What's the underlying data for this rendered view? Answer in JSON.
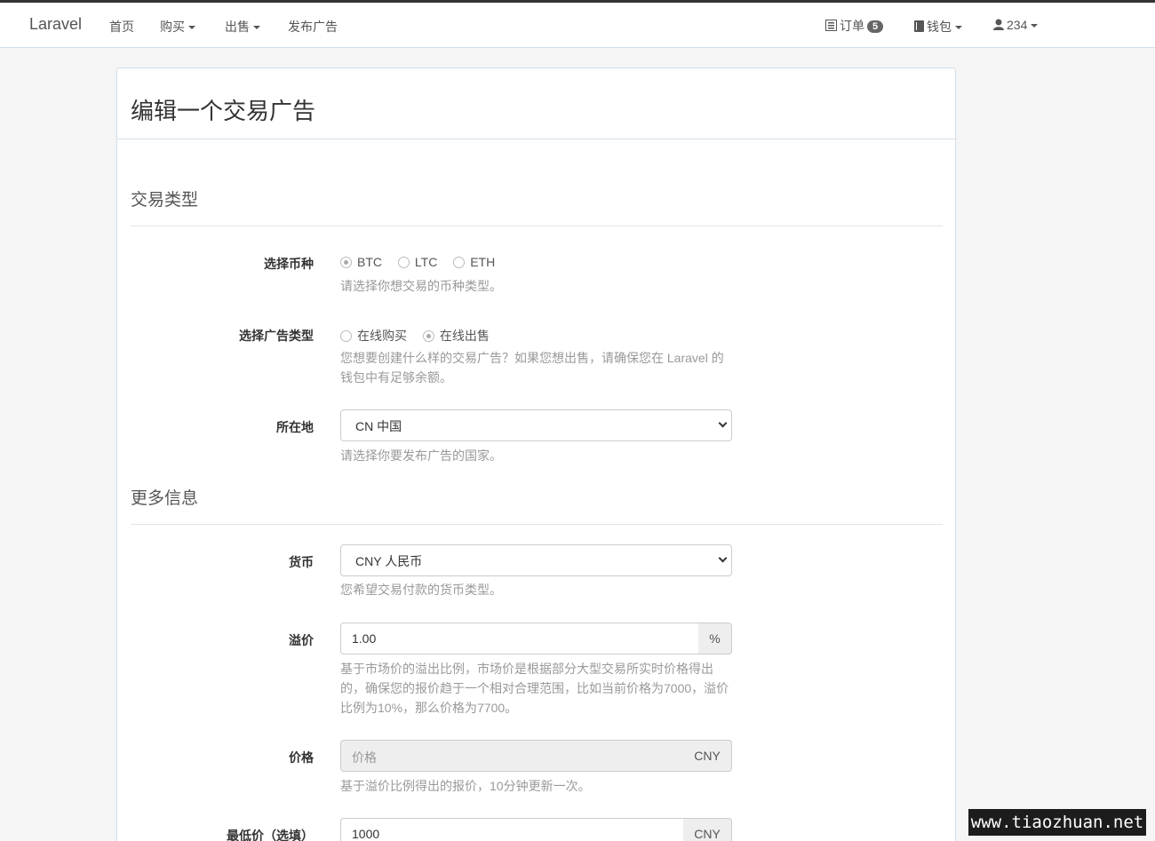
{
  "navbar": {
    "brand": "Laravel",
    "home": "首页",
    "buy": "购买",
    "sell": "出售",
    "post_ad": "发布广告",
    "orders": "订单",
    "orders_badge": "5",
    "wallet": "钱包",
    "user": "234"
  },
  "panel": {
    "title": "编辑一个交易广告"
  },
  "section_trade_type": {
    "title": "交易类型",
    "coin": {
      "label": "选择币种",
      "options": [
        "BTC",
        "LTC",
        "ETH"
      ],
      "selected": "BTC",
      "help": "请选择你想交易的币种类型。"
    },
    "ad_type": {
      "label": "选择广告类型",
      "options": [
        "在线购买",
        "在线出售"
      ],
      "selected": "在线出售",
      "help_line1": "您想要创建什么样的交易广告？如果您想出售，请确保您在 Laravel 的",
      "help_line2": "钱包中有足够余额。"
    },
    "location": {
      "label": "所在地",
      "value": "CN 中国",
      "help": "请选择你要发布广告的国家。"
    }
  },
  "section_more_info": {
    "title": "更多信息",
    "currency": {
      "label": "货币",
      "value": "CNY 人民币",
      "help": "您希望交易付款的货币类型。"
    },
    "premium": {
      "label": "溢价",
      "value": "1.00",
      "addon": "%",
      "help_line1": "基于市场价的溢出比例，市场价是根据部分大型交易所实时价格得出",
      "help_line2": "的，确保您的报价趋于一个相对合理范围，比如当前价格为7000，溢价",
      "help_line3": "比例为10%，那么价格为7700。"
    },
    "price": {
      "label": "价格",
      "placeholder": "价格",
      "addon": "CNY",
      "help": "基于溢价比例得出的报价，10分钟更新一次。"
    },
    "min_price": {
      "label": "最低价（选填）",
      "value": "1000",
      "addon": "CNY"
    }
  },
  "watermark": "www.tiaozhuan.net"
}
